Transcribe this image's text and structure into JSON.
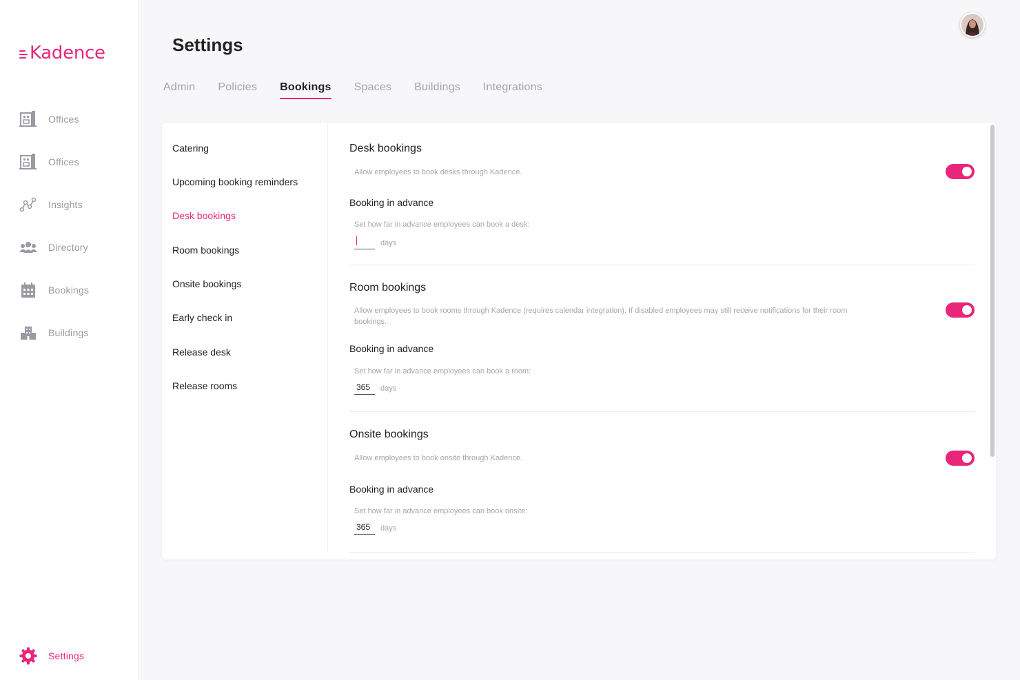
{
  "brand": {
    "name": "Kadence",
    "accent": "#e8267a"
  },
  "sidebar": {
    "items": [
      {
        "label": "Offices",
        "icon": "office-building-icon"
      },
      {
        "label": "Offices",
        "icon": "office-building-icon"
      },
      {
        "label": "Insights",
        "icon": "insights-chart-icon"
      },
      {
        "label": "Directory",
        "icon": "people-icon"
      },
      {
        "label": "Bookings",
        "icon": "calendar-icon"
      },
      {
        "label": "Buildings",
        "icon": "buildings-icon"
      }
    ],
    "settings_label": "Settings"
  },
  "header": {
    "title": "Settings"
  },
  "tabs": [
    {
      "label": "Admin"
    },
    {
      "label": "Policies"
    },
    {
      "label": "Bookings",
      "active": true
    },
    {
      "label": "Spaces"
    },
    {
      "label": "Buildings"
    },
    {
      "label": "Integrations"
    }
  ],
  "subnav": [
    {
      "label": "Catering"
    },
    {
      "label": "Upcoming booking reminders"
    },
    {
      "label": "Desk bookings",
      "active": true
    },
    {
      "label": "Room bookings"
    },
    {
      "label": "Onsite bookings"
    },
    {
      "label": "Early check in"
    },
    {
      "label": "Release desk"
    },
    {
      "label": "Release rooms"
    }
  ],
  "sections": {
    "desk": {
      "title": "Desk bookings",
      "description": "Allow employees to book desks through Kadence.",
      "enabled": true,
      "advance_title": "Booking in advance",
      "advance_desc": "Set how far in advance employees can book a desk:",
      "days_value": "",
      "days_unit": "days"
    },
    "room": {
      "title": "Room bookings",
      "description": "Allow employees to book rooms through Kadence (requires calendar integration). If disabled employees may still receive notifications for their room bookings.",
      "enabled": true,
      "advance_title": "Booking in advance",
      "advance_desc": "Set how far in advance employees can book a room:",
      "days_value": "365",
      "days_unit": "days"
    },
    "onsite": {
      "title": "Onsite bookings",
      "description": "Allow employees to book onsite through Kadence.",
      "enabled": true,
      "advance_title": "Booking in advance",
      "advance_desc": "Set how far in advance employees can book onsite:",
      "days_value": "365",
      "days_unit": "days"
    }
  }
}
